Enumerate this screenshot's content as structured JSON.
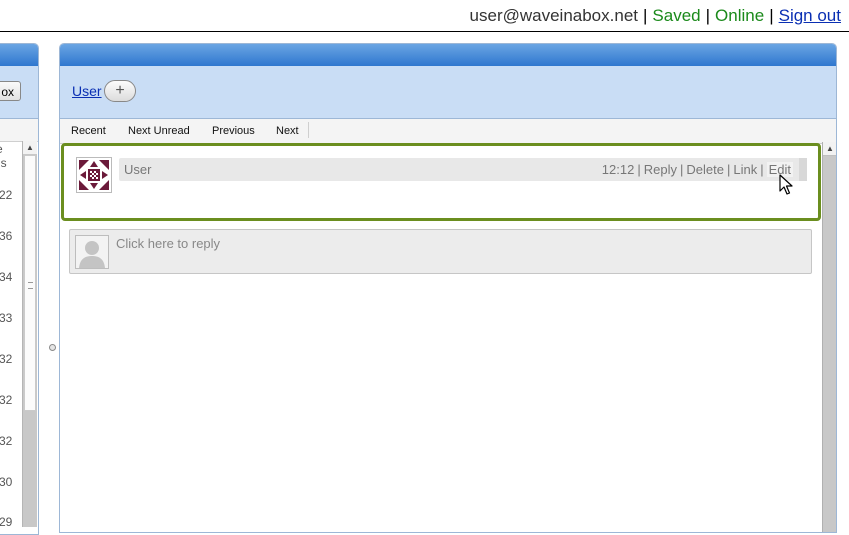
{
  "topbar": {
    "user_email": "user@waveinabox.net",
    "separator": "|",
    "saved_status": "Saved",
    "online_status": "Online",
    "sign_out": "Sign out",
    "colors": {
      "status_green": "#1b8a1b",
      "link_blue": "#0a2fb3"
    }
  },
  "left_panel": {
    "inbox_button_fragment": "ox",
    "header_fragments": [
      "e",
      "gs"
    ],
    "list_values": [
      "22",
      "36",
      "34",
      "33",
      "32",
      "32",
      "32",
      "30",
      "29"
    ]
  },
  "wave": {
    "participants": [
      {
        "name": "User"
      }
    ],
    "add_participant_icon": "plus-icon",
    "toolbar": {
      "recent": "Recent",
      "next_unread": "Next Unread",
      "previous": "Previous",
      "next": "Next"
    },
    "blip": {
      "author": "User",
      "time": "12:12",
      "actions": {
        "reply": "Reply",
        "delete": "Delete",
        "link": "Link",
        "edit": "Edit"
      },
      "border_color": "#6b8e1f"
    },
    "reply_placeholder": "Click here to reply"
  }
}
